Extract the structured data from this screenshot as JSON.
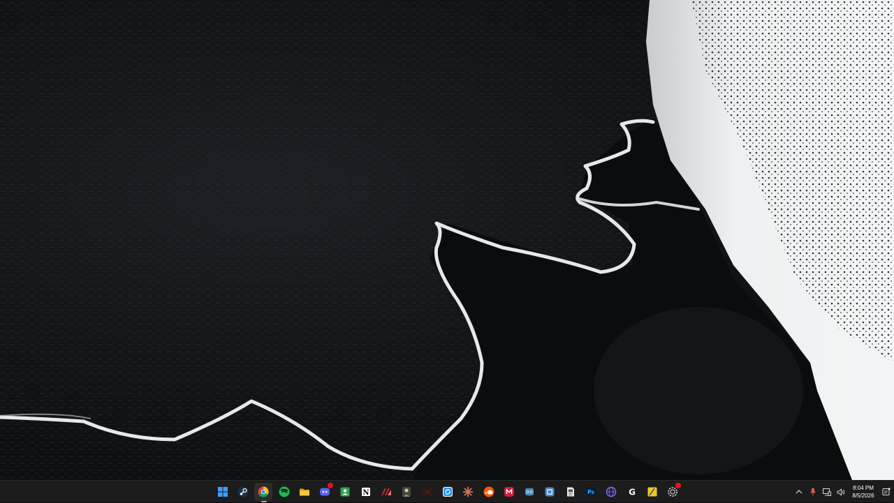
{
  "taskbar": {
    "apps": [
      {
        "name": "start-button",
        "icon": "windows-logo-icon",
        "color": "#3aa0ff",
        "active": false
      },
      {
        "name": "steam-button",
        "icon": "steam-icon",
        "color": "#1b3a5a",
        "active": false
      },
      {
        "name": "chrome-button",
        "icon": "chrome-icon",
        "color": "#f4c20d",
        "active": true
      },
      {
        "name": "spotify-button",
        "icon": "spotify-icon",
        "color": "#1db954",
        "active": false
      },
      {
        "name": "file-explorer-button",
        "icon": "folder-icon",
        "color": "#f2c94c",
        "active": false
      },
      {
        "name": "discord-button",
        "icon": "discord-icon",
        "color": "#5865f2",
        "active": false,
        "badge": true
      },
      {
        "name": "contacts-app-button",
        "icon": "contact-card-icon",
        "color": "#2ea44f",
        "active": false
      },
      {
        "name": "notion-button",
        "icon": "notion-icon",
        "color": "#ffffff",
        "active": false
      },
      {
        "name": "red-slash-app-button",
        "icon": "red-slash-icon",
        "color": "#d42a2a",
        "active": false
      },
      {
        "name": "portrait-app-button",
        "icon": "portrait-icon",
        "color": "#7a8a78",
        "active": false
      },
      {
        "name": "spider-app-button",
        "icon": "spider-icon",
        "color": "#5a1a1a",
        "active": false
      },
      {
        "name": "sync-app-button",
        "icon": "sync-icon",
        "color": "#2196f3",
        "active": false
      },
      {
        "name": "claude-button",
        "icon": "claude-starburst-icon",
        "color": "#d97757",
        "active": false
      },
      {
        "name": "soundcloud-button",
        "icon": "soundcloud-icon",
        "color": "#ff5500",
        "active": false
      },
      {
        "name": "red-app-button",
        "icon": "red-app-icon",
        "color": "#d01c3a",
        "active": false
      },
      {
        "name": "godot-button",
        "icon": "godot-icon",
        "color": "#478cbf",
        "active": false
      },
      {
        "name": "blue-app-button",
        "icon": "blue-app-icon",
        "color": "#4f86c6",
        "active": false
      },
      {
        "name": "document-app-button",
        "icon": "document-icon",
        "color": "#b8b8b8",
        "active": false
      },
      {
        "name": "photoshop-button",
        "icon": "photoshop-icon",
        "color": "#001e36",
        "active": false
      },
      {
        "name": "browser-button",
        "icon": "globe-icon",
        "color": "#7a6cf0",
        "active": false
      },
      {
        "name": "g-app-button",
        "icon": "g-letter-icon",
        "color": "#2a2a2a",
        "active": false
      },
      {
        "name": "sticky-notes-button",
        "icon": "sticky-note-icon",
        "color": "#f5c518",
        "active": false
      },
      {
        "name": "settings-app-button",
        "icon": "gear-icon",
        "color": "#3a3a3a",
        "active": false,
        "badge": true
      }
    ],
    "labels": {
      "notion": "N",
      "photoshop": "Ps",
      "g": "G"
    }
  },
  "tray": {
    "icons": [
      {
        "name": "show-hidden-icons-button",
        "icon": "chevron-up-icon"
      },
      {
        "name": "microphone-icon",
        "icon": "microphone-icon"
      },
      {
        "name": "network-icon",
        "icon": "network-icon"
      },
      {
        "name": "volume-icon",
        "icon": "volume-icon"
      }
    ],
    "clock": {
      "time": "8:04 PM",
      "date": "8/5/2026"
    }
  },
  "colors": {
    "taskbar_bg": "#1c1c1c",
    "accent_red": "#e81123"
  }
}
